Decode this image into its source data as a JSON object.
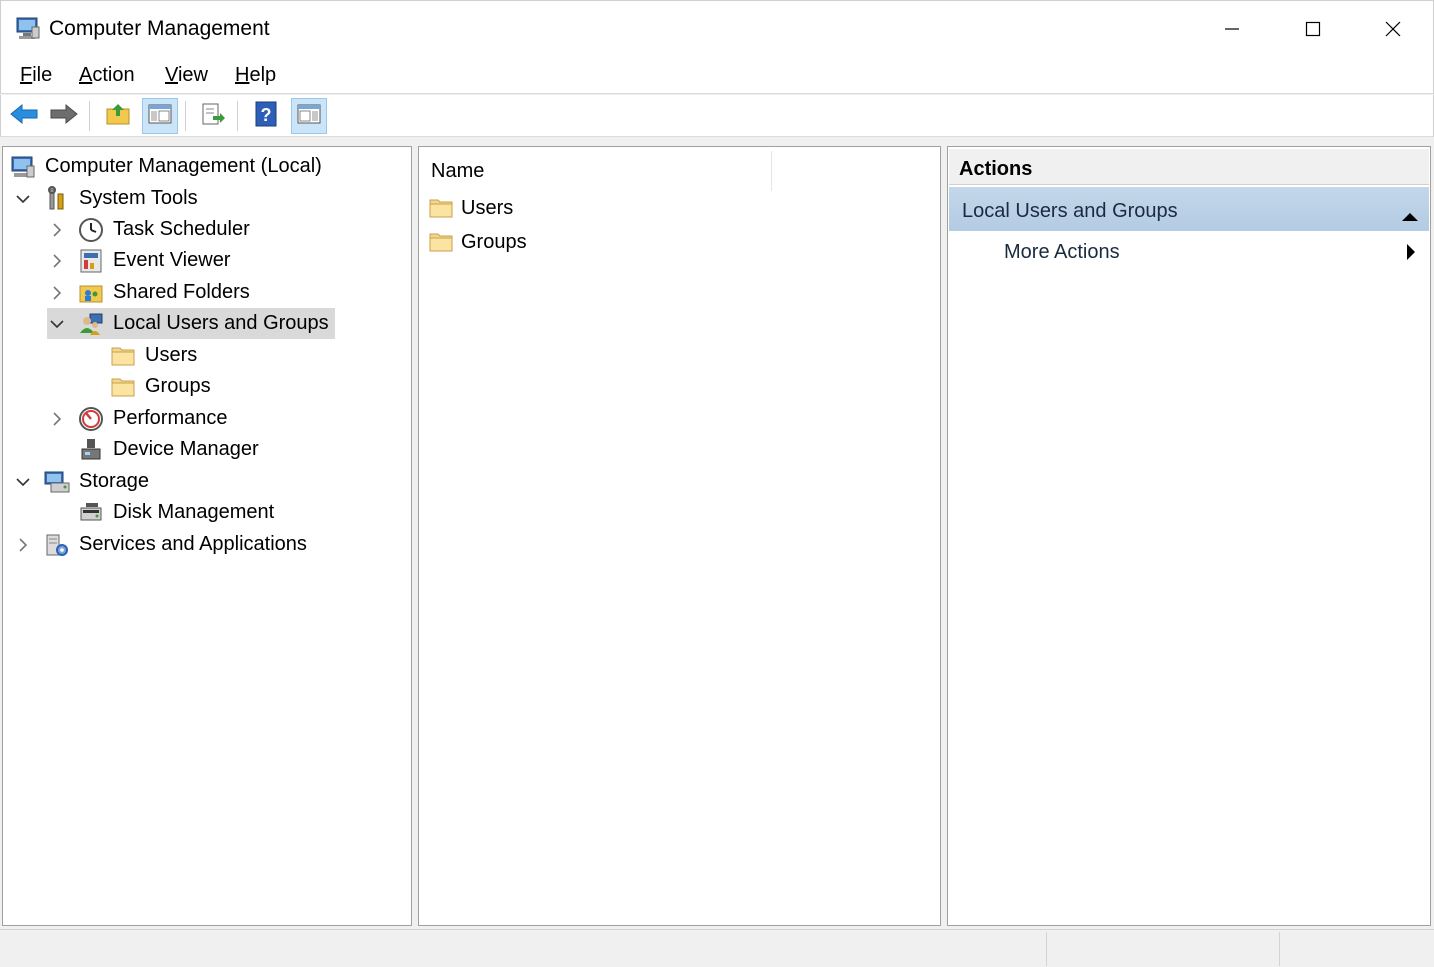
{
  "window": {
    "title": "Computer Management",
    "icon": "computer-management-icon"
  },
  "menu": [
    {
      "label": "File",
      "accel": "F",
      "rest": "ile"
    },
    {
      "label": "Action",
      "accel": "A",
      "rest": "ction"
    },
    {
      "label": "View",
      "accel": "V",
      "rest": "iew"
    },
    {
      "label": "Help",
      "accel": "H",
      "rest": "elp"
    }
  ],
  "toolbar": {
    "buttons": [
      "back-arrow-icon",
      "forward-arrow-icon",
      "up-folder-icon",
      "show-hide-console-tree-icon",
      "export-list-icon",
      "help-icon",
      "show-hide-action-pane-icon"
    ]
  },
  "tree": {
    "root": "Computer Management (Local)",
    "system_tools": "System Tools",
    "task_scheduler": "Task Scheduler",
    "event_viewer": "Event Viewer",
    "shared_folders": "Shared Folders",
    "local_users_groups": "Local Users and Groups",
    "users": "Users",
    "groups": "Groups",
    "performance": "Performance",
    "device_manager": "Device Manager",
    "storage": "Storage",
    "disk_management": "Disk Management",
    "services_apps": "Services and Applications"
  },
  "list": {
    "column_name": "Name",
    "items": [
      "Users",
      "Groups"
    ]
  },
  "actions": {
    "title": "Actions",
    "section": "Local Users and Groups",
    "more": "More Actions"
  },
  "colors": {
    "selection": "#d9d9d9",
    "action_header": "#b3cbe3",
    "folder": "#f5d58a"
  }
}
